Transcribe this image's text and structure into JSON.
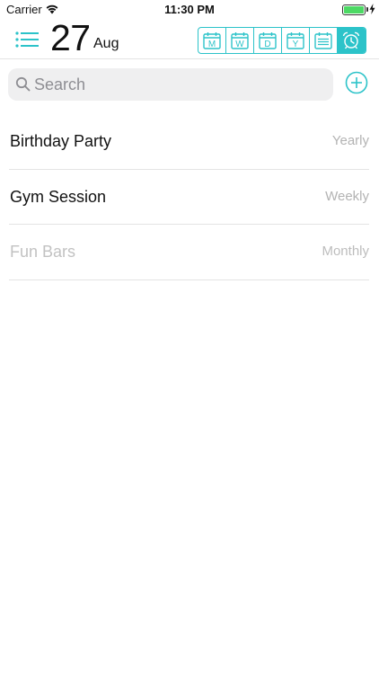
{
  "status_bar": {
    "carrier": "Carrier",
    "time": "11:30 PM",
    "battery_level": 1.0
  },
  "header": {
    "day": "27",
    "month": "Aug",
    "views": [
      {
        "letter": "M",
        "icon": "month-calendar-icon",
        "active": false
      },
      {
        "letter": "W",
        "icon": "week-calendar-icon",
        "active": false
      },
      {
        "letter": "D",
        "icon": "day-calendar-icon",
        "active": false
      },
      {
        "letter": "Y",
        "icon": "year-calendar-icon",
        "active": false
      },
      {
        "letter": "",
        "icon": "list-calendar-icon",
        "active": false
      },
      {
        "letter": "",
        "icon": "alarm-clock-icon",
        "active": true
      }
    ]
  },
  "search": {
    "placeholder": "Search",
    "value": ""
  },
  "events": [
    {
      "name": "Birthday Party",
      "frequency": "Yearly",
      "dimmed": false
    },
    {
      "name": "Gym Session",
      "frequency": "Weekly",
      "dimmed": false
    },
    {
      "name": "Fun Bars",
      "frequency": "Monthly",
      "dimmed": true
    }
  ],
  "colors": {
    "accent": "#2cc3c9",
    "battery": "#4cd964",
    "secondary_text": "#b3b3b3",
    "search_bg": "#efeff0"
  }
}
